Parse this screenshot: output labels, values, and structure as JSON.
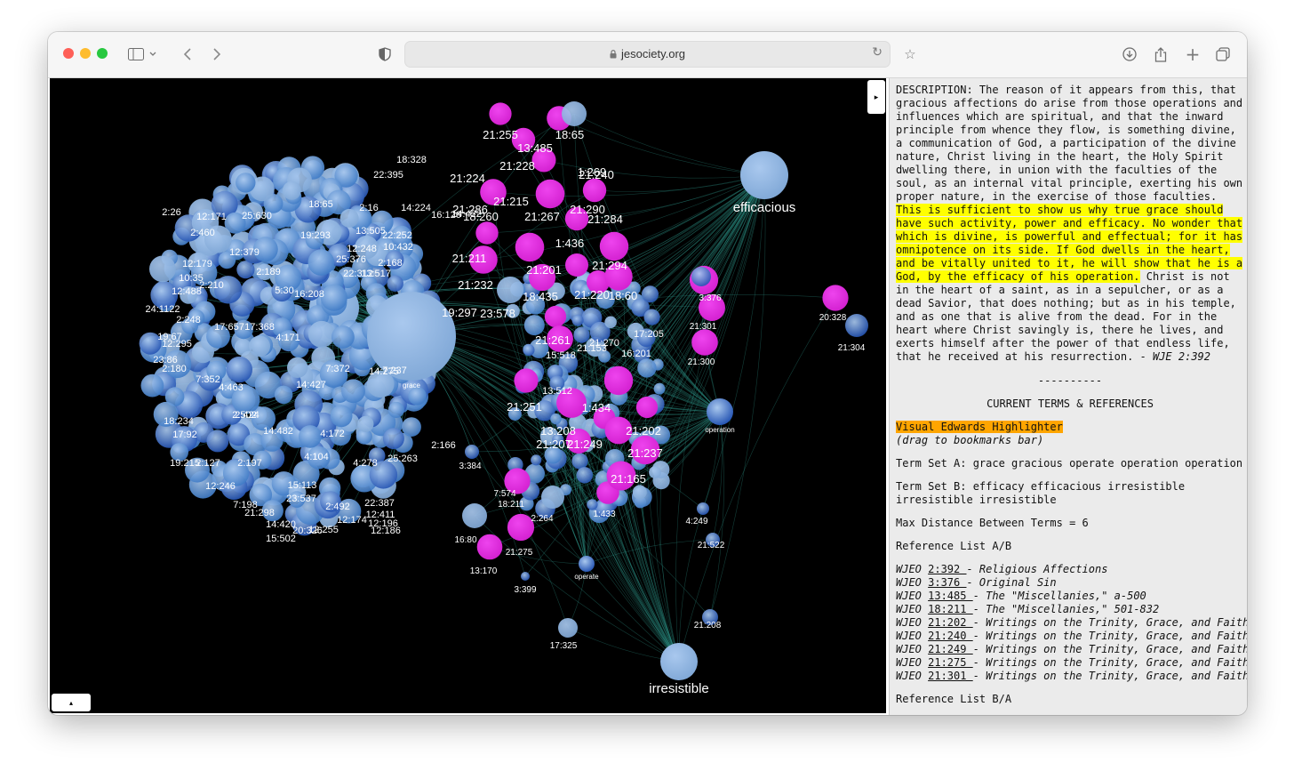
{
  "browser": {
    "url": "jesociety.org",
    "icons": [
      "close-dot",
      "minimize-dot",
      "zoom-dot",
      "sidebar-icon",
      "chevron-down-icon",
      "back-icon",
      "forward-icon",
      "shield-icon",
      "lock-icon",
      "reload-icon",
      "star-icon",
      "download-icon",
      "share-icon",
      "plus-icon",
      "tabs-icon"
    ],
    "traffic_colors": [
      "#fe5f57",
      "#febc2e",
      "#28c840"
    ]
  },
  "graph": {
    "toggle_right": "▸",
    "toggle_bottom": "▴",
    "colors": {
      "light": "#7fa7d6",
      "mid": "#3b78c4",
      "dark": "#1f4fb0",
      "magenta": "#d21fcf",
      "edge": "#2a8a7e"
    },
    "hubs": [
      {
        "label": "efficacious",
        "kind": "light"
      },
      {
        "label": "irresistible",
        "kind": "light"
      },
      {
        "label": "grace",
        "kind": "light"
      },
      {
        "label": "operation",
        "kind": "dark"
      },
      {
        "label": "operate",
        "kind": "dark"
      }
    ],
    "labels": [
      "21:255",
      "13:485",
      "18:65",
      "21:228",
      "1:269",
      "21:240",
      "21:224",
      "21:215",
      "21:286",
      "18:260",
      "21:267",
      "21:290",
      "21:284",
      "1:436",
      "21:201",
      "21:294",
      "21:232",
      "23:578",
      "19:297",
      "21:211",
      "18:435",
      "21:220",
      "18:60",
      "21:261",
      "21:251",
      "1:434",
      "13:208",
      "21:207",
      "21:249",
      "21:202",
      "21:237",
      "21:165",
      "21:300",
      "21:301",
      "3:376",
      "20:328",
      "21:304",
      "18:211",
      "2:264",
      "1:433",
      "16:80",
      "21:275",
      "13:170",
      "17:325",
      "21:208",
      "21:522",
      "4:249",
      "3:399",
      "3:384",
      "7:574",
      "25:630",
      "16:208",
      "19:293",
      "22:312",
      "4:171",
      "7:372",
      "14:275",
      "7:237",
      "14:427",
      "4:463",
      "17:657",
      "17:368",
      "2:210",
      "12:379",
      "2:189",
      "12:179",
      "12:488",
      "2:248",
      "12:295",
      "23:86",
      "2:180",
      "7:352",
      "18:234",
      "14:482",
      "4:172",
      "2:166",
      "4:104",
      "4:278",
      "25:263",
      "2:127",
      "2:197",
      "15:113",
      "23:537",
      "2:492",
      "22:387",
      "12:411",
      "12:196",
      "12:174",
      "12:186",
      "14:420",
      "12:255",
      "15:502",
      "20:326",
      "21:298",
      "7:198",
      "12:246",
      "19:215",
      "17:92",
      "2:502",
      "2:424",
      "13:512",
      "15:518",
      "21:153",
      "16:201",
      "21:270",
      "17:205",
      "24:1122",
      "19:67",
      "2:26",
      "2:460",
      "12:171",
      "10:35",
      "2:16",
      "14:224",
      "16:126",
      "14:422",
      "22:395",
      "18:328",
      "18:65",
      "13:505",
      "22:252",
      "10:432",
      "12:248",
      "25:376",
      "13:517",
      "2:168",
      "5:30"
    ],
    "edge_count": 260
  },
  "panel": {
    "description_before": "DESCRIPTION: The reason of it appears from this, that gracious affections do arise from those operations and influences which are spiritual, and that the inward principle from whence they flow, is something divine, a communication of God, a participation of the divine nature, Christ living in the heart, the Holy Spirit dwelling there, in union with the faculties of the soul, as an internal vital principle, exerting his own proper nature, in the exercise of those faculties. ",
    "description_highlight": "This is sufficient to show us why true grace should have such activity, power and efficacy. No wonder that which is divine, is powerful and effectual; for it has omnipotence on its side. If God dwells in the heart, and be vitally united to it, he will show that he is a God, by the efficacy of his operation.",
    "description_after": " Christ is not in the heart of a saint, as in a sepulcher, or as a dead Savior, that does nothing; but as in his temple, and as one that is alive from the dead. For in the heart where Christ savingly is, there he lives, and exerts himself after the power of that endless life, that he received at his resurrection. - ",
    "description_cite": "WJE 2:392",
    "separator": "----------",
    "section_title": "CURRENT TERMS & REFERENCES",
    "highlighter_link": "Visual Edwards Highlighter ",
    "highlighter_note": "(drag to bookmarks bar)",
    "term_set_a": "Term Set A: grace gracious operate operation operation",
    "term_set_b": "Term Set B: efficacy efficacious irresistible irresistible irresistible",
    "max_distance": "Max Distance Between Terms = 6",
    "reference_title": "Reference List A/B",
    "references": [
      {
        "prefix": "WJEO ",
        "ref": "2:392 ",
        "title": "- Religious Affections"
      },
      {
        "prefix": "WJEO ",
        "ref": "3:376 ",
        "title": "- Original Sin"
      },
      {
        "prefix": "WJEO ",
        "ref": "13:485 ",
        "title": "- The \"Miscellanies,\" a-500"
      },
      {
        "prefix": "WJEO ",
        "ref": "18:211 ",
        "title": "- The \"Miscellanies,\" 501-832"
      },
      {
        "prefix": "WJEO ",
        "ref": "21:202 ",
        "title": "- Writings on the Trinity, Grace, and Faith"
      },
      {
        "prefix": "WJEO ",
        "ref": "21:240 ",
        "title": "- Writings on the Trinity, Grace, and Faith"
      },
      {
        "prefix": "WJEO ",
        "ref": "21:249 ",
        "title": "- Writings on the Trinity, Grace, and Faith"
      },
      {
        "prefix": "WJEO ",
        "ref": "21:275 ",
        "title": "- Writings on the Trinity, Grace, and Faith"
      },
      {
        "prefix": "WJEO ",
        "ref": "21:301 ",
        "title": "- Writings on the Trinity, Grace, and Faith"
      }
    ],
    "cutoff_text": "Reference List B/A"
  }
}
